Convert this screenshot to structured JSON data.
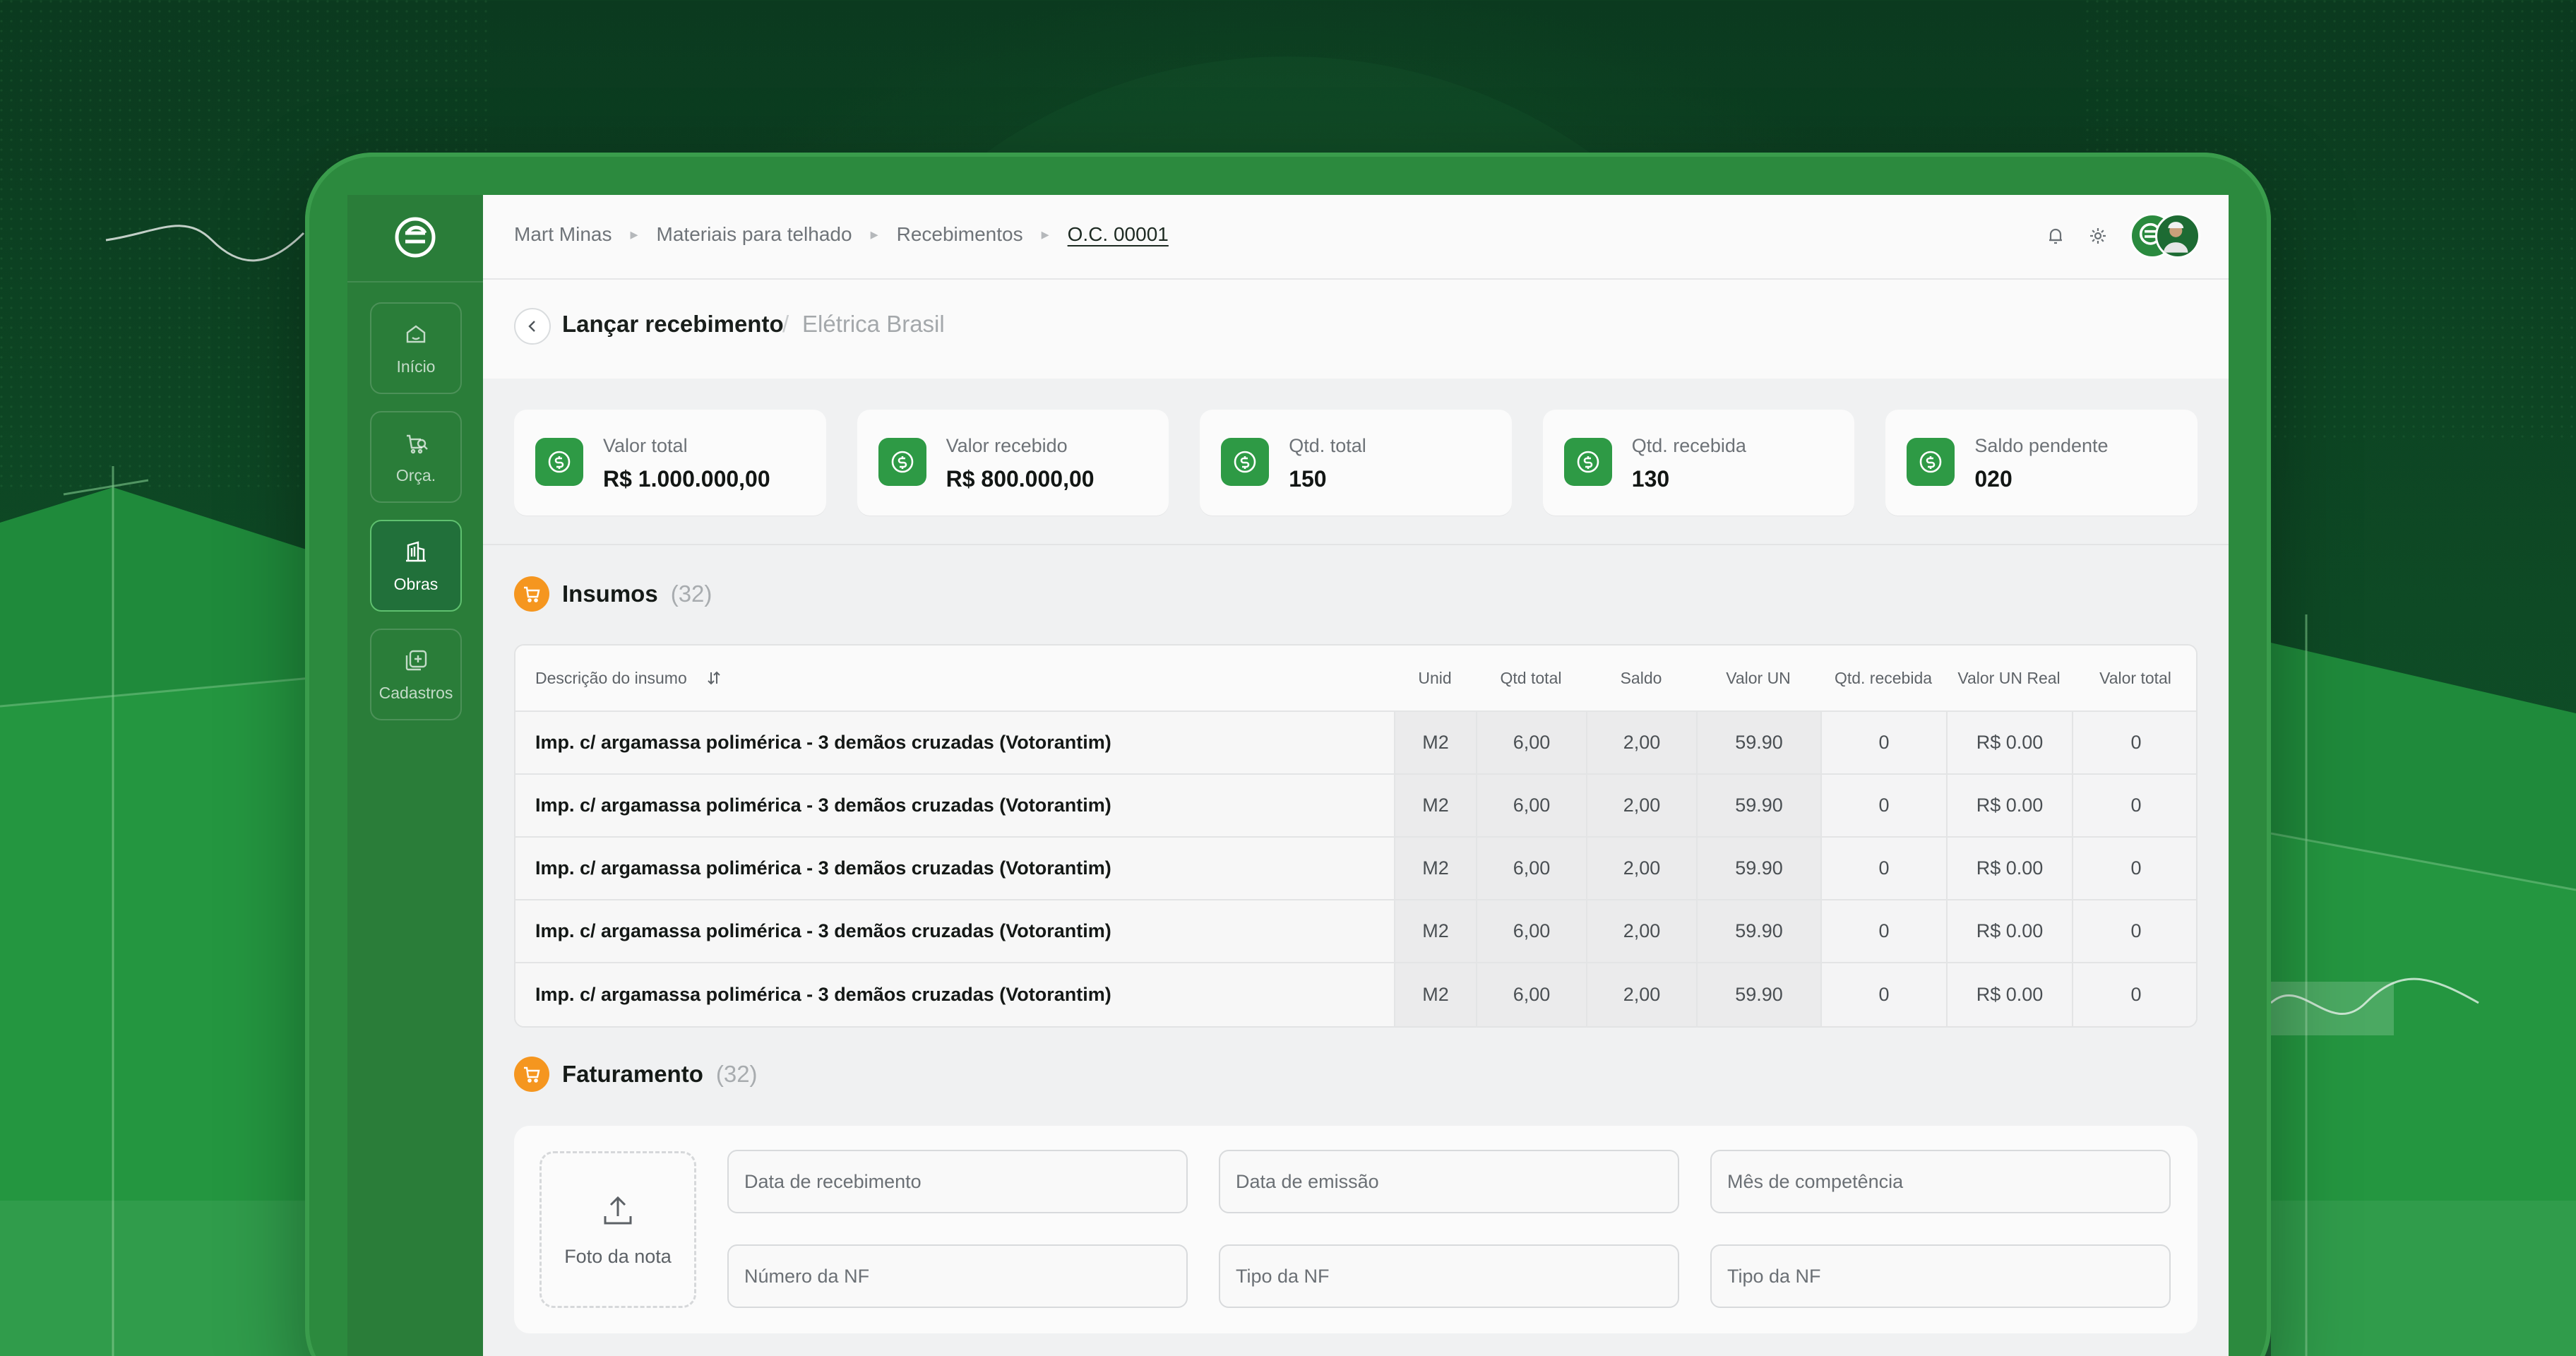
{
  "breadcrumb": [
    "Mart Minas",
    "Materiais para telhado",
    "Recebimentos",
    "O.C. 00001"
  ],
  "sidebar": {
    "items": [
      {
        "label": "Início",
        "icon": "home-icon",
        "active": false
      },
      {
        "label": "Orça.",
        "icon": "budget-cart-icon",
        "active": false
      },
      {
        "label": "Obras",
        "icon": "building-icon",
        "active": true
      },
      {
        "label": "Cadastros",
        "icon": "add-square-icon",
        "active": false
      }
    ]
  },
  "header": {
    "title": "Lançar recebimento",
    "subtitle": "Elétrica Brasil"
  },
  "stats": [
    {
      "label": "Valor total",
      "value": "R$ 1.000.000,00"
    },
    {
      "label": "Valor recebido",
      "value": "R$ 800.000,00"
    },
    {
      "label": "Qtd. total",
      "value": "150"
    },
    {
      "label": "Qtd. recebida",
      "value": "130"
    },
    {
      "label": "Saldo pendente",
      "value": "020"
    }
  ],
  "insumos": {
    "title": "Insumos",
    "count": "(32)",
    "columns": [
      "Descrição do insumo",
      "Unid",
      "Qtd total",
      "Saldo",
      "Valor UN",
      "Qtd. recebida",
      "Valor UN Real",
      "Valor total"
    ],
    "rows": [
      [
        "Imp. c/ argamassa polimérica - 3 demãos cruzadas (Votorantim)",
        "M2",
        "6,00",
        "2,00",
        "59.90",
        "0",
        "R$ 0.00",
        "0"
      ],
      [
        "Imp. c/ argamassa polimérica - 3 demãos cruzadas (Votorantim)",
        "M2",
        "6,00",
        "2,00",
        "59.90",
        "0",
        "R$ 0.00",
        "0"
      ],
      [
        "Imp. c/ argamassa polimérica - 3 demãos cruzadas (Votorantim)",
        "M2",
        "6,00",
        "2,00",
        "59.90",
        "0",
        "R$ 0.00",
        "0"
      ],
      [
        "Imp. c/ argamassa polimérica - 3 demãos cruzadas (Votorantim)",
        "M2",
        "6,00",
        "2,00",
        "59.90",
        "0",
        "R$ 0.00",
        "0"
      ],
      [
        "Imp. c/ argamassa polimérica - 3 demãos cruzadas (Votorantim)",
        "M2",
        "6,00",
        "2,00",
        "59.90",
        "0",
        "R$ 0.00",
        "0"
      ]
    ]
  },
  "faturamento": {
    "title": "Faturamento",
    "count": "(32)",
    "upload_label": "Foto da nota",
    "fields": [
      {
        "placeholder": "Data de recebimento"
      },
      {
        "placeholder": "Data de emissão"
      },
      {
        "placeholder": "Mês de competência"
      },
      {
        "placeholder": "Número da NF"
      },
      {
        "placeholder": "Tipo da NF"
      },
      {
        "placeholder": "Tipo da NF"
      }
    ]
  },
  "colors": {
    "brand_green": "#2a7d39",
    "accent_green": "#2e9a45",
    "orange": "#f5961f",
    "background_dark": "#0b3a1f"
  }
}
